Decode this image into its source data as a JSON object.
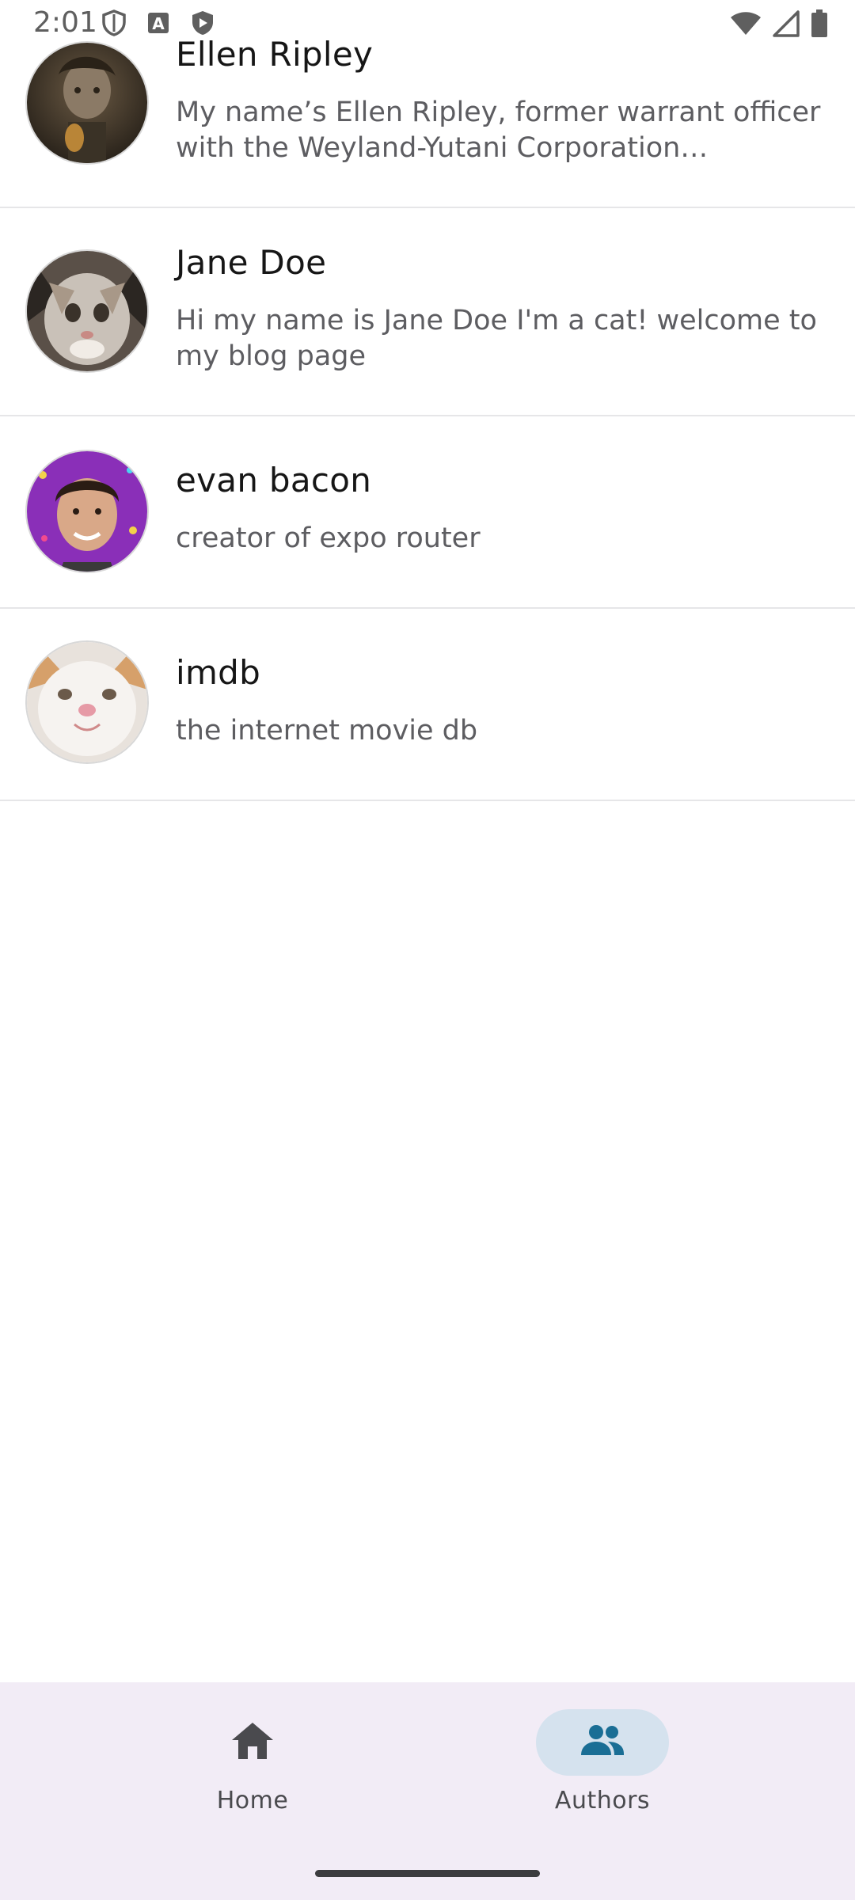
{
  "status_bar": {
    "time": "2:01",
    "left_icons": [
      "shield-outline-icon",
      "font-a-icon",
      "shield-play-icon"
    ],
    "right_icons": [
      "wifi-icon",
      "signal-icon",
      "battery-icon"
    ]
  },
  "authors": [
    {
      "name": "Ellen Ripley",
      "bio": "My name’s Ellen Ripley, former warrant officer with the Weyland-Yutani Corporation…",
      "avatar": "ellen-ripley-photo"
    },
    {
      "name": "Jane Doe",
      "bio": "Hi my name is Jane Doe I'm a cat! welcome to my blog page",
      "avatar": "cat-photo"
    },
    {
      "name": "evan bacon",
      "bio": "creator of expo router",
      "avatar": "evan-bacon-photo"
    },
    {
      "name": "imdb",
      "bio": "the internet movie db",
      "avatar": "white-cat-photo"
    }
  ],
  "bottom_nav": {
    "items": [
      {
        "label": "Home",
        "icon": "home-icon",
        "active": false
      },
      {
        "label": "Authors",
        "icon": "people-icon",
        "active": true
      }
    ]
  },
  "colors": {
    "nav_background": "#f2ecf6",
    "active_pill": "#d5e2ee",
    "active_icon": "#1a6e95",
    "inactive_icon": "#4a4a4e"
  }
}
